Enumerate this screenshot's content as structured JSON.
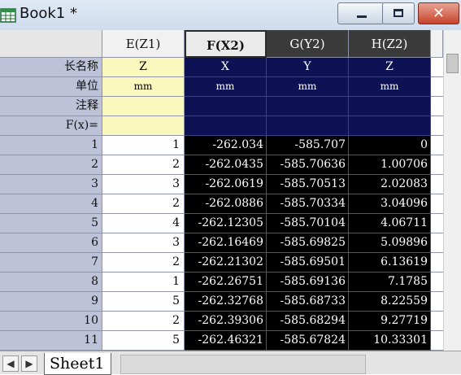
{
  "window": {
    "title": "Book1 *",
    "minimize_icon": "minimize-icon",
    "maximize_icon": "maximize-icon",
    "close_label": "✕"
  },
  "columns": {
    "E": {
      "header": "E(Z1)",
      "long_name": "Z",
      "units": "mm"
    },
    "F": {
      "header": "F(X2)",
      "long_name": "X",
      "units": "mm"
    },
    "G": {
      "header": "G(Y2)",
      "long_name": "Y",
      "units": "mm"
    },
    "H": {
      "header": "H(Z2)",
      "long_name": "Z",
      "units": "mm"
    }
  },
  "row_labels": {
    "long_name": "长名称",
    "units": "单位",
    "comments": "注释",
    "formula": "F(x)="
  },
  "rows": [
    {
      "n": "1",
      "e": "1",
      "f": "-262.034",
      "g": "-585.707",
      "h": "0"
    },
    {
      "n": "2",
      "e": "2",
      "f": "-262.0435",
      "g": "-585.70636",
      "h": "1.00706"
    },
    {
      "n": "3",
      "e": "3",
      "f": "-262.0619",
      "g": "-585.70513",
      "h": "2.02083"
    },
    {
      "n": "4",
      "e": "2",
      "f": "-262.0886",
      "g": "-585.70334",
      "h": "3.04096"
    },
    {
      "n": "5",
      "e": "4",
      "f": "-262.12305",
      "g": "-585.70104",
      "h": "4.06711"
    },
    {
      "n": "6",
      "e": "3",
      "f": "-262.16469",
      "g": "-585.69825",
      "h": "5.09896"
    },
    {
      "n": "7",
      "e": "2",
      "f": "-262.21302",
      "g": "-585.69501",
      "h": "6.13619"
    },
    {
      "n": "8",
      "e": "1",
      "f": "-262.26751",
      "g": "-585.69136",
      "h": "7.1785"
    },
    {
      "n": "9",
      "e": "5",
      "f": "-262.32768",
      "g": "-585.68733",
      "h": "8.22559"
    },
    {
      "n": "10",
      "e": "2",
      "f": "-262.39306",
      "g": "-585.68294",
      "h": "9.27719"
    },
    {
      "n": "11",
      "e": "5",
      "f": "-262.46321",
      "g": "-585.67824",
      "h": "10.33301"
    }
  ],
  "tabs": {
    "first": "◀",
    "next": "▶",
    "sheet": "Sheet1"
  },
  "colors": {
    "row_header": "#bec2d9",
    "label_rows_selected": "#0d1255",
    "data_selected": "#000000",
    "column_e_label": "#fbf8be"
  }
}
